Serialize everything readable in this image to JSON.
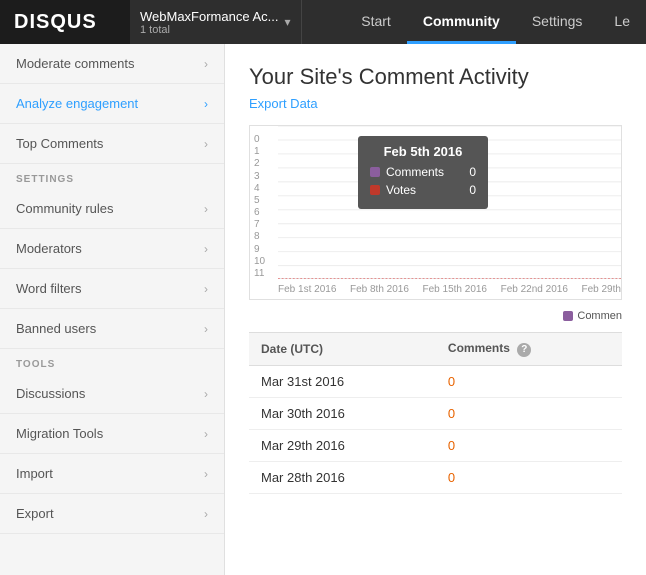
{
  "logo": "DISQUS",
  "site": {
    "name": "WebMaxFormance Ac...",
    "count": "1 total"
  },
  "nav": {
    "links": [
      {
        "id": "start",
        "label": "Start",
        "active": false
      },
      {
        "id": "community",
        "label": "Community",
        "active": true
      },
      {
        "id": "settings",
        "label": "Settings",
        "active": false
      },
      {
        "id": "le",
        "label": "Le",
        "active": false
      }
    ]
  },
  "sidebar": {
    "main_items": [
      {
        "id": "moderate-comments",
        "label": "Moderate comments",
        "active": false
      },
      {
        "id": "analyze-engagement",
        "label": "Analyze engagement",
        "active": true
      },
      {
        "id": "top-comments",
        "label": "Top Comments",
        "active": false
      }
    ],
    "settings_label": "SETTINGS",
    "settings_items": [
      {
        "id": "community-rules",
        "label": "Community rules",
        "active": false
      },
      {
        "id": "moderators",
        "label": "Moderators",
        "active": false
      },
      {
        "id": "word-filters",
        "label": "Word filters",
        "active": false
      },
      {
        "id": "banned-users",
        "label": "Banned users",
        "active": false
      }
    ],
    "tools_label": "TOOLS",
    "tools_items": [
      {
        "id": "discussions",
        "label": "Discussions",
        "active": false
      },
      {
        "id": "migration-tools",
        "label": "Migration Tools",
        "active": false
      },
      {
        "id": "import",
        "label": "Import",
        "active": false
      },
      {
        "id": "export",
        "label": "Export",
        "active": false
      }
    ]
  },
  "content": {
    "title": "Your Site's Comment Activity",
    "export_label": "Export Data",
    "chart": {
      "tooltip_date": "Feb 5th 2016",
      "tooltip_rows": [
        {
          "label": "Comments",
          "value": "0",
          "color": "#8b5e9e"
        },
        {
          "label": "Votes",
          "value": "0",
          "color": "#c0392b"
        }
      ],
      "yaxis": [
        "11",
        "10",
        "9",
        "8",
        "7",
        "6",
        "5",
        "4",
        "3",
        "2",
        "1",
        "0"
      ],
      "xaxis": [
        "Feb 1st 2016",
        "Feb 8th 2016",
        "Feb 15th 2016",
        "Feb 22nd 2016",
        "Feb 29th"
      ],
      "legend_label": "Commen",
      "legend_color": "#8b5e9e"
    },
    "table": {
      "col_date": "Date (UTC)",
      "col_comments": "Comments",
      "rows": [
        {
          "date": "Mar 31st 2016",
          "comments": "0"
        },
        {
          "date": "Mar 30th 2016",
          "comments": "0"
        },
        {
          "date": "Mar 29th 2016",
          "comments": "0"
        },
        {
          "date": "Mar 28th 2016",
          "comments": "0"
        }
      ]
    }
  }
}
